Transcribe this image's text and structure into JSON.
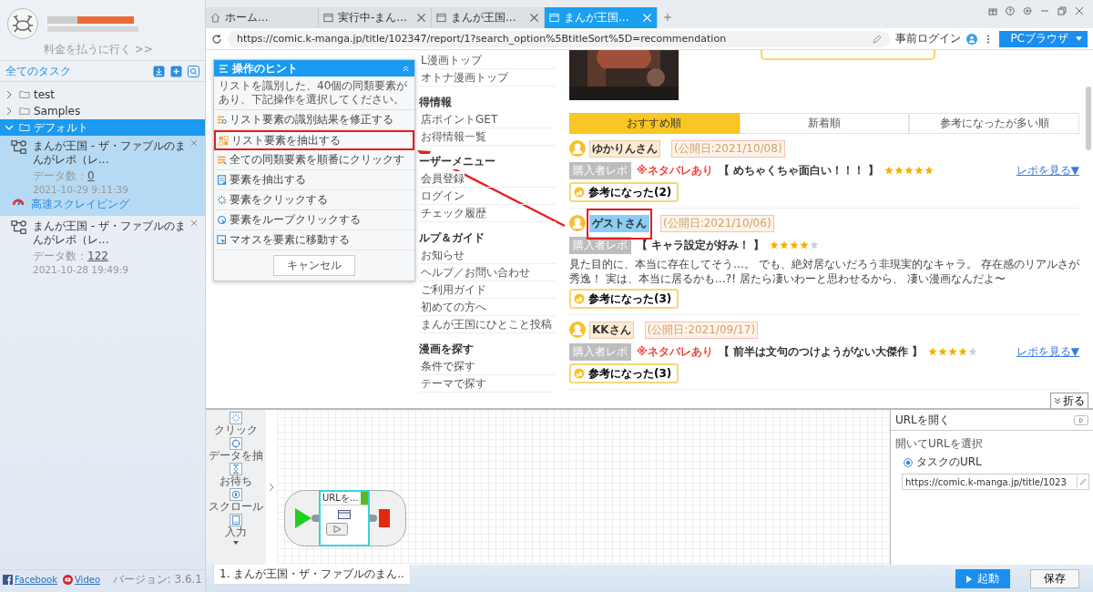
{
  "sidebar": {
    "pay_link": "料金を払うに行く >>",
    "all_tasks": "全てのタスク",
    "tree": [
      {
        "label": "test",
        "expanded": false,
        "selected": false
      },
      {
        "label": "Samples",
        "expanded": false,
        "selected": false
      },
      {
        "label": "デフォルト",
        "expanded": true,
        "selected": true,
        "children": [
          {
            "title": "まんが王国 - ザ・ファブルのまんがレポ（レ...",
            "count_label": "データ数：",
            "count": "0",
            "date": "2021-10-29 9:11:39",
            "selected": true,
            "mode": "高速スクレイピング"
          },
          {
            "title": "まんが王国 - ザ・ファブルのまんがレポ（レ...",
            "count_label": "データ数：",
            "count": "122",
            "date": "2021-10-28 19:49:9",
            "selected": false
          }
        ]
      }
    ],
    "footer_links": [
      {
        "kind": "facebook",
        "label": "Facebook"
      },
      {
        "kind": "video",
        "label": "Video"
      }
    ],
    "version": "バージョン: 3.6.1"
  },
  "browser": {
    "tabs": [
      {
        "kind": "home",
        "label": "ホーム...",
        "selected": false,
        "closable": false
      },
      {
        "kind": "page",
        "label": "実行中-まん...",
        "selected": false,
        "closable": true
      },
      {
        "kind": "page",
        "label": "まんが王国...",
        "selected": false,
        "closable": true
      },
      {
        "kind": "page",
        "label": "まんが王国...",
        "selected": true,
        "closable": true
      }
    ],
    "url": "https://comic.k-manga.jp/title/102347/report/1?search_option%5BtitleSort%5D=recommendation",
    "login": "事前ログイン",
    "mode_button": "PCブラウザ"
  },
  "page": {
    "nav": [
      {
        "items": [
          "L漫画トップ",
          "オトナ漫画トップ"
        ]
      },
      {
        "heading": "得情報",
        "items": [
          "店ポイントGET",
          "お得情報一覧"
        ]
      },
      {
        "heading": "ーザーメニュー",
        "items": [
          "会員登録",
          "ログイン",
          "チェック履歴"
        ]
      },
      {
        "heading": "ルプ＆ガイド",
        "items": [
          "お知らせ",
          "ヘルプ／お問い合わせ",
          "ご利用ガイド",
          "初めての方へ",
          "まんが王国にひとこと投稿"
        ]
      },
      {
        "heading": "漫画を探す",
        "items": [
          "条件で探す",
          "テーマで探す"
        ]
      }
    ],
    "sort_tabs": [
      {
        "label": "おすすめ順",
        "selected": true
      },
      {
        "label": "新着順",
        "selected": false
      },
      {
        "label": "参考になったが多い順",
        "selected": false
      }
    ],
    "reviews": [
      {
        "name": "ゆかりんさん",
        "date": "(公開日:2021/10/08)",
        "selected": false,
        "marked": false,
        "badge": "購入者レポ",
        "spoiler": "※ネタバレあり",
        "title": "【 めちゃくちゃ面白い！！！ 】",
        "stars": 5,
        "more": "レポを見る▼",
        "helpful": "参考になった(2)"
      },
      {
        "name": "ゲストさん",
        "date": "(公開日:2021/10/06)",
        "selected": true,
        "marked": true,
        "badge": "購入者レポ",
        "title": "【 キャラ設定が好み！ 】",
        "stars": 4,
        "body": "見た目的に、本当に存在してそう…。 でも、絶対居ないだろう非現実的なキャラ。 存在感のリアルさが秀逸！ 実は、本当に居るかも…?! 居たら凄いわーと思わせるから、 凄い漫画なんだよ〜",
        "helpful": "参考になった(3)"
      },
      {
        "name": "KKさん",
        "date": "(公開日:2021/09/17)",
        "selected": false,
        "marked": false,
        "badge": "購入者レポ",
        "spoiler": "※ネタバレあり",
        "title": "【 前半は文句のつけようがない大傑作 】",
        "stars": 4,
        "more": "レポを見る▼",
        "helpful": "参考になった(3)"
      }
    ],
    "collapse_button": "折る"
  },
  "hint_popup": {
    "title": "操作のヒント",
    "message": "リストを識別した、40個の同類要素があり、下記操作を選択してください。",
    "items": [
      {
        "kind": "fix",
        "label": "リスト要素の識別結果を修正する",
        "marked": false
      },
      {
        "kind": "extract_list",
        "label": "リスト要素を抽出する",
        "marked": true
      },
      {
        "kind": "click_all",
        "label": "全ての同類要素を順番にクリックす",
        "marked": false
      },
      {
        "kind": "extract",
        "label": "要素を抽出する",
        "marked": false
      },
      {
        "kind": "click",
        "label": "要素をクリックする",
        "marked": false
      },
      {
        "kind": "loop",
        "label": "要素をループクリックする",
        "marked": false
      },
      {
        "kind": "hover",
        "label": "マオスを要素に移動する",
        "marked": false
      }
    ],
    "cancel": "キャンセル"
  },
  "workflow": {
    "tools": [
      {
        "kind": "click",
        "label": "クリック"
      },
      {
        "kind": "extract",
        "label": "データを抽"
      },
      {
        "kind": "wait",
        "label": "お待ち"
      },
      {
        "kind": "scroll",
        "label": "スクロール"
      },
      {
        "kind": "input",
        "label": "入力"
      }
    ],
    "node": "URLを...",
    "task_tab": "1. まんが王国・ザ・ファブルのまん.."
  },
  "properties": {
    "title": "URLを開く",
    "label": "開いてURLを選択",
    "options": [
      {
        "label": "タスクのURL",
        "selected": true
      }
    ],
    "url": "https://comic.k-manga.jp/title/1023"
  },
  "actions": {
    "run": "起動",
    "save": "保存"
  }
}
